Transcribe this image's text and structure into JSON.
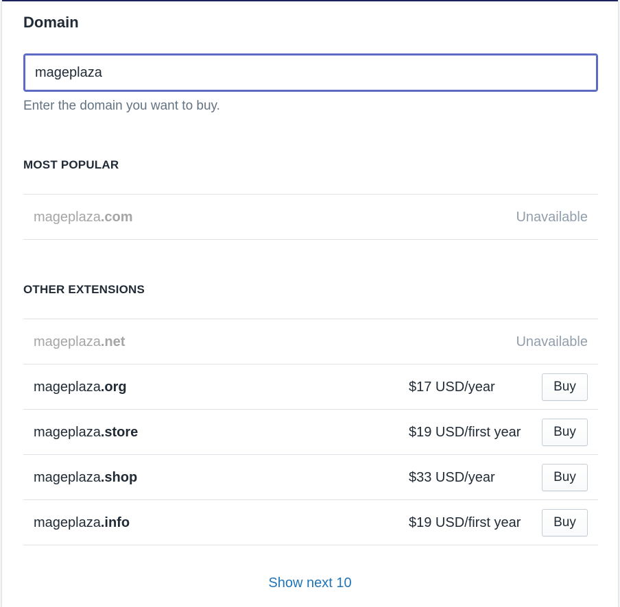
{
  "domain_section": {
    "title": "Domain",
    "input_value": "mageplaza",
    "help_text": "Enter the domain you want to buy."
  },
  "most_popular": {
    "heading": "MOST POPULAR",
    "items": [
      {
        "base": "mageplaza",
        "ext": ".com",
        "status": "Unavailable"
      }
    ]
  },
  "other_extensions": {
    "heading": "OTHER EXTENSIONS",
    "items": [
      {
        "base": "mageplaza",
        "ext": ".net",
        "status": "Unavailable"
      },
      {
        "base": "mageplaza",
        "ext": ".org",
        "price": "$17 USD/year",
        "button": "Buy"
      },
      {
        "base": "mageplaza",
        "ext": ".store",
        "price": "$19 USD/first year",
        "button": "Buy"
      },
      {
        "base": "mageplaza",
        "ext": ".shop",
        "price": "$33 USD/year",
        "button": "Buy"
      },
      {
        "base": "mageplaza",
        "ext": ".info",
        "price": "$19 USD/first year",
        "button": "Buy"
      }
    ]
  },
  "show_next_label": "Show next 10",
  "colors": {
    "accent": "#5c6ac4",
    "link": "#1f73b7",
    "unavailable_text": "#a5a5a5"
  }
}
